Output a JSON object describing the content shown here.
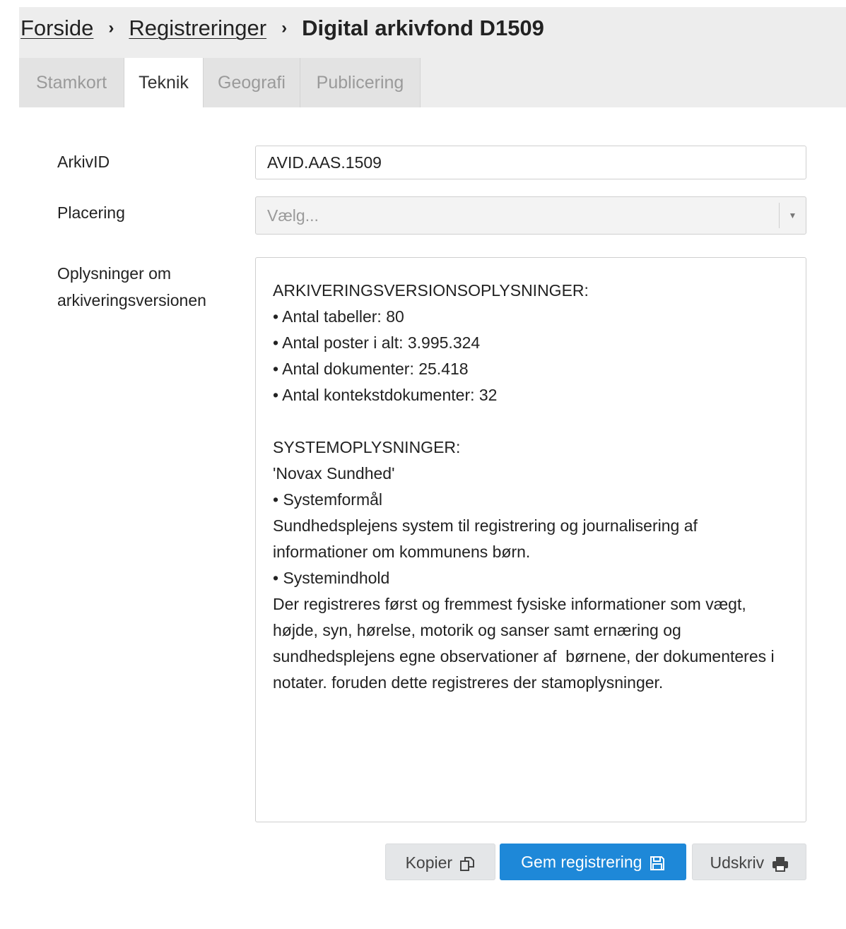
{
  "breadcrumb": {
    "home": "Forside",
    "registrations": "Registreringer",
    "current": "Digital arkivfond D1509",
    "separator": "›"
  },
  "tabs": [
    {
      "label": "Stamkort"
    },
    {
      "label": "Teknik"
    },
    {
      "label": "Geografi"
    },
    {
      "label": "Publicering"
    }
  ],
  "active_tab": "Teknik",
  "form": {
    "arkivid_label": "ArkivID",
    "arkivid_value": "AVID.AAS.1509",
    "placering_label": "Placering",
    "placering_placeholder": "Vælg...",
    "info_label": "Oplysninger om arkiveringsversionen",
    "info_value": "ARKIVERINGSVERSIONSOPLYSNINGER:\n• Antal tabeller: 80\n• Antal poster i alt: 3.995.324\n• Antal dokumenter: 25.418\n• Antal kontekstdokumenter: 32\n\nSYSTEMOPLYSNINGER:\n'Novax Sundhed'\n• Systemformål\nSundhedsplejens system til registrering og journalisering af informationer om kommunens børn.\n• Systemindhold\nDer registreres først og fremmest fysiske informationer som vægt, højde, syn, hørelse, motorik og sanser samt ernæring og sundhedsplejens egne observationer af  børnene, der dokumenteres i notater. foruden dette registreres der stamoplysninger."
  },
  "buttons": {
    "copy": "Kopier",
    "save": "Gem registrering",
    "print": "Udskriv"
  },
  "icons": {
    "copy": "copy-icon",
    "save": "floppy-disk-icon",
    "print": "printer-icon",
    "caret": "caret-down-icon"
  },
  "colors": {
    "primary": "#1e88d8",
    "background": "#ededed"
  }
}
